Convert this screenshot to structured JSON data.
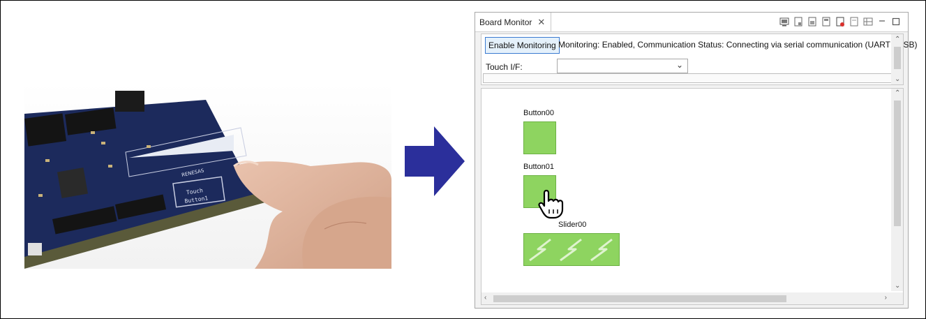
{
  "arrow_color": "#2b2f9b",
  "widget_color": "#8ed460",
  "board_monitor": {
    "tab_title": "Board Monitor",
    "enable_button": "Enable Monitoring",
    "status_text": "Monitoring: Enabled, Communication Status: Connecting via serial communication (UART / USB)",
    "touch_if_label": "Touch I/F:",
    "touch_if_value": "",
    "widgets": [
      {
        "label": "Button00",
        "type": "button"
      },
      {
        "label": "Button01",
        "type": "button",
        "touched": true
      },
      {
        "label": "Slider00",
        "type": "slider"
      }
    ]
  },
  "photo": {
    "description_icon": "finger-touching-board-photo",
    "board_silkscreen": {
      "maker": "RENESAS",
      "touch_label": "Touch",
      "button_label": "Button1"
    }
  }
}
